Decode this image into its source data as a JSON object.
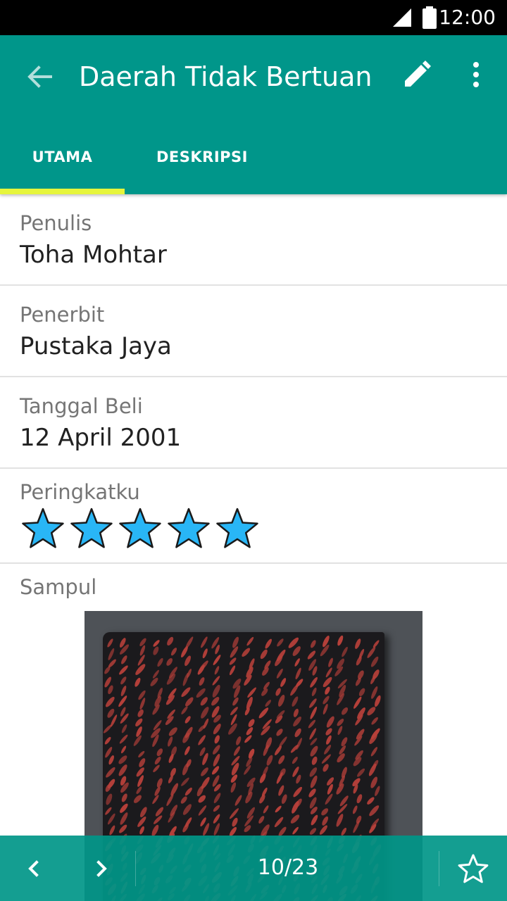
{
  "status": {
    "time": "12:00"
  },
  "toolbar": {
    "title": "Daerah Tidak Bertuan"
  },
  "tabs": [
    {
      "label": "UTAMA",
      "selected": true
    },
    {
      "label": "DESKRIPSI",
      "selected": false
    }
  ],
  "fields": {
    "penulis": {
      "label": "Penulis",
      "value": "Toha Mohtar"
    },
    "penerbit": {
      "label": "Penerbit",
      "value": "Pustaka Jaya"
    },
    "tanggal": {
      "label": "Tanggal Beli",
      "value": "12 April 2001"
    },
    "rating": {
      "label": "Peringkatku",
      "value": 5,
      "max": 5
    },
    "sampul": {
      "label": "Sampul"
    }
  },
  "pager": {
    "counter": "10/23"
  },
  "colors": {
    "primary": "#00968a",
    "accent": "#e6f53c",
    "star": "#29b6f6"
  },
  "icons": [
    "back-arrow-icon",
    "pencil-icon",
    "more-vert-icon",
    "chevron-left-icon",
    "chevron-right-icon",
    "star-outline-icon"
  ]
}
